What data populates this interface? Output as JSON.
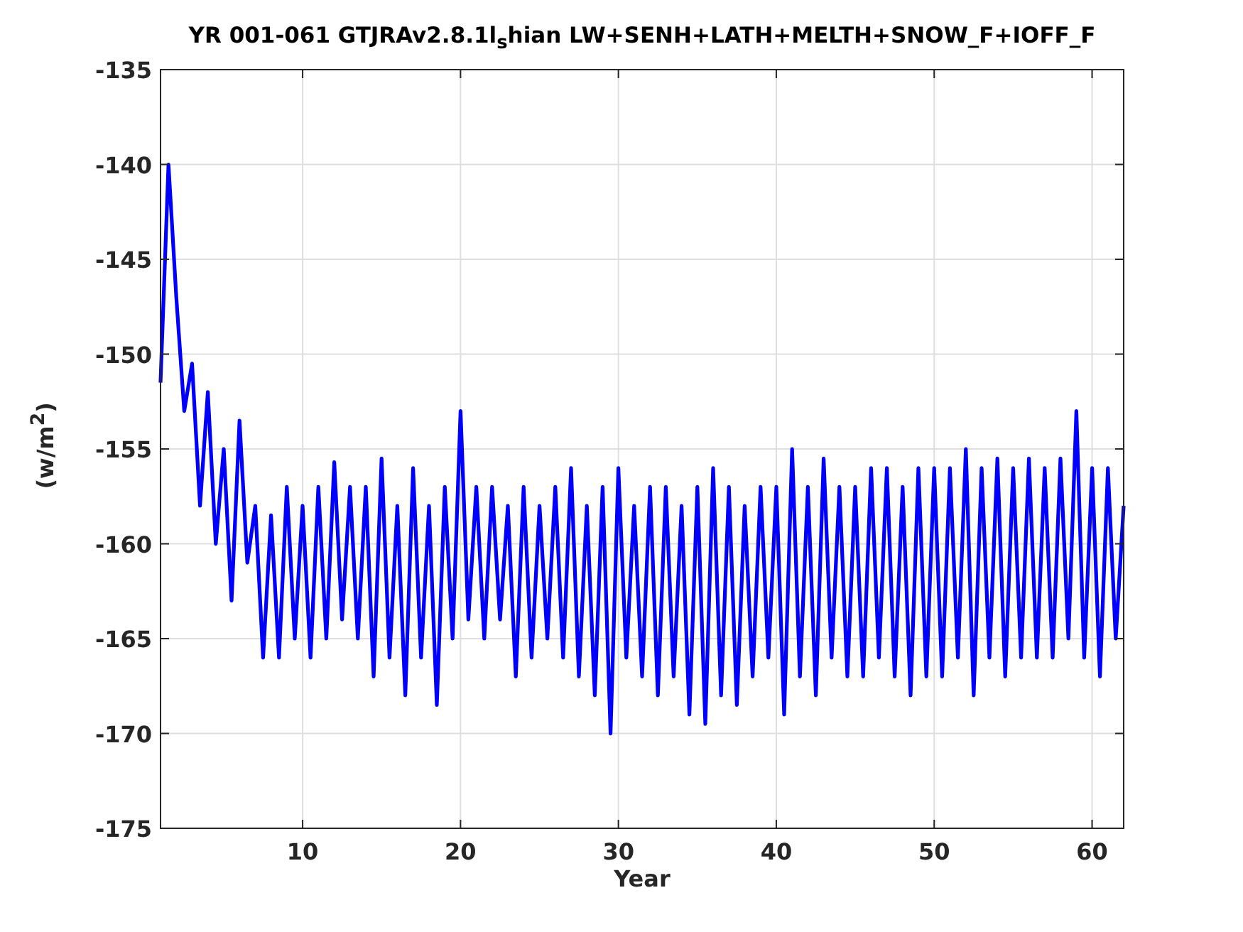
{
  "figure": {
    "title": "YR 001-061 GTJRAv2.8.1l$_{s}$hian LW+SENH+LATH+MELTH+SNOW_F+IOFF_F",
    "chart_data": {
      "type": "line",
      "xlabel": "Year",
      "ylabel": "(w/m$^{2}$)",
      "xlim": [
        1,
        62
      ],
      "ylim": [
        -175,
        -135
      ],
      "xticks": [
        10,
        20,
        30,
        40,
        50,
        60
      ],
      "yticks": [
        -175,
        -170,
        -165,
        -160,
        -155,
        -150,
        -145,
        -140,
        -135
      ],
      "x": [
        1,
        1.5,
        2,
        2.5,
        3,
        3.5,
        4,
        4.5,
        5,
        5.5,
        6,
        6.5,
        7,
        7.5,
        8,
        8.5,
        9,
        9.5,
        10,
        10.5,
        11,
        11.5,
        12,
        12.5,
        13,
        13.5,
        14,
        14.5,
        15,
        15.5,
        16,
        16.5,
        17,
        17.5,
        18,
        18.5,
        19,
        19.5,
        20,
        20.5,
        21,
        21.5,
        22,
        22.5,
        23,
        23.5,
        24,
        24.5,
        25,
        25.5,
        26,
        26.5,
        27,
        27.5,
        28,
        28.5,
        29,
        29.5,
        30,
        30.5,
        31,
        31.5,
        32,
        32.5,
        33,
        33.5,
        34,
        34.5,
        35,
        35.5,
        36,
        36.5,
        37,
        37.5,
        38,
        38.5,
        39,
        39.5,
        40,
        40.5,
        41,
        41.5,
        42,
        42.5,
        43,
        43.5,
        44,
        44.5,
        45,
        45.5,
        46,
        46.5,
        47,
        47.5,
        48,
        48.5,
        49,
        49.5,
        50,
        50.5,
        51,
        51.5,
        52,
        52.5,
        53,
        53.5,
        54,
        54.5,
        55,
        55.5,
        56,
        56.5,
        57,
        57.5,
        58,
        58.5,
        59,
        59.5,
        60,
        60.5,
        61,
        61.5,
        62
      ],
      "grid": true,
      "series": [
        {
          "color": "#0000ff",
          "values": [
            -151.5,
            -140,
            -147,
            -153,
            -150.5,
            -158,
            -152,
            -160,
            -155,
            -163,
            -153.5,
            -161,
            -158,
            -166,
            -158.5,
            -166,
            -157,
            -165,
            -158,
            -166,
            -157,
            -165,
            -155.7,
            -164,
            -157,
            -165,
            -157,
            -167,
            -155.5,
            -166,
            -158,
            -168,
            -156,
            -166,
            -158,
            -168.5,
            -157,
            -165,
            -153,
            -164,
            -157,
            -165,
            -157,
            -164,
            -158,
            -167,
            -157,
            -166,
            -158,
            -165,
            -157,
            -166,
            -156,
            -167,
            -158,
            -168,
            -157,
            -170,
            -156,
            -166,
            -158,
            -167,
            -157,
            -168,
            -157,
            -167,
            -158,
            -169,
            -157,
            -169.5,
            -156,
            -168,
            -157,
            -168.5,
            -158,
            -167,
            -157,
            -166,
            -157,
            -169,
            -155,
            -167,
            -157,
            -168,
            -155.5,
            -166,
            -157,
            -167,
            -157,
            -167,
            -156,
            -166,
            -156,
            -167,
            -157,
            -168,
            -156,
            -167,
            -156,
            -167,
            -156,
            -166,
            -155,
            -168,
            -156,
            -166,
            -155.5,
            -167,
            -156,
            -166,
            -155.5,
            -166,
            -156,
            -166,
            -155.5,
            -165,
            -153,
            -166,
            -156,
            -167,
            -156,
            -165,
            -158
          ]
        }
      ]
    }
  }
}
